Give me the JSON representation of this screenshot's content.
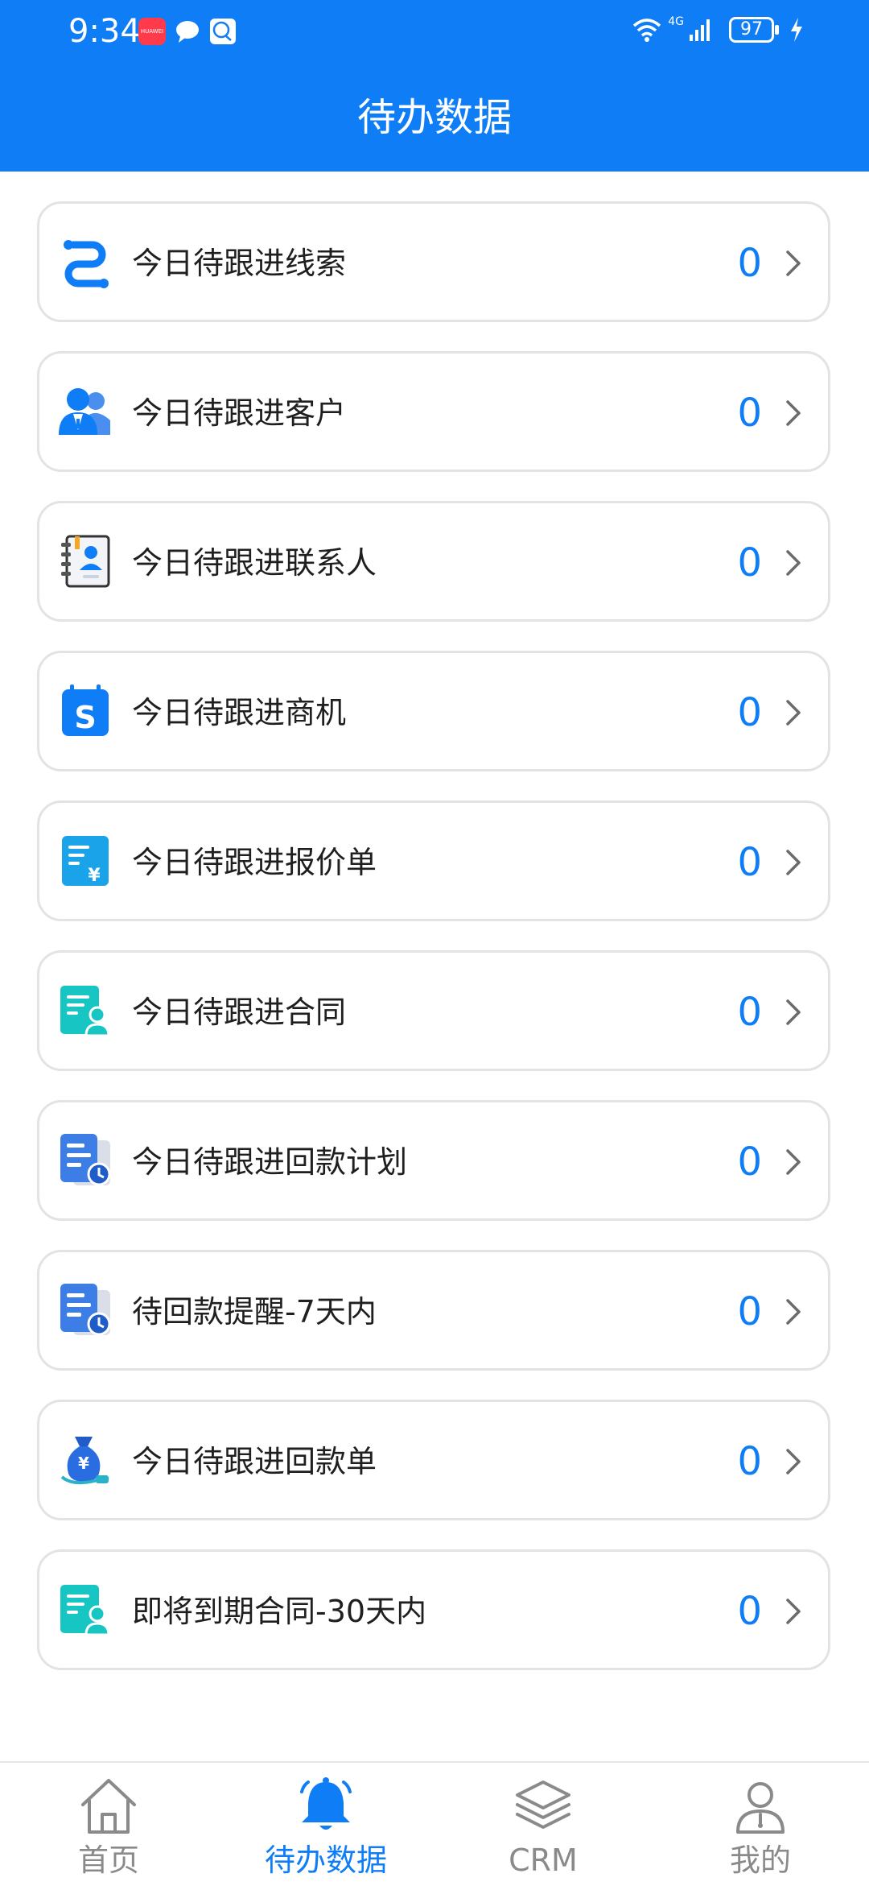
{
  "status_bar": {
    "time": "9:34",
    "notif_app": "HUAWEI",
    "network": "4G",
    "battery": "97"
  },
  "header": {
    "title": "待办数据"
  },
  "items": [
    {
      "label": "今日待跟进线索",
      "count": "0",
      "icon": "leads-icon"
    },
    {
      "label": "今日待跟进客户",
      "count": "0",
      "icon": "customers-icon"
    },
    {
      "label": "今日待跟进联系人",
      "count": "0",
      "icon": "contacts-icon"
    },
    {
      "label": "今日待跟进商机",
      "count": "0",
      "icon": "opportunity-icon"
    },
    {
      "label": "今日待跟进报价单",
      "count": "0",
      "icon": "quotation-icon"
    },
    {
      "label": "今日待跟进合同",
      "count": "0",
      "icon": "contract-icon"
    },
    {
      "label": "今日待跟进回款计划",
      "count": "0",
      "icon": "payment-plan-icon"
    },
    {
      "label": "待回款提醒-7天内",
      "count": "0",
      "icon": "payment-plan-icon"
    },
    {
      "label": "今日待跟进回款单",
      "count": "0",
      "icon": "money-bag-icon"
    },
    {
      "label": "即将到期合同-30天内",
      "count": "0",
      "icon": "contract-icon"
    }
  ],
  "nav": [
    {
      "label": "首页",
      "icon": "home-icon",
      "active": false
    },
    {
      "label": "待办数据",
      "icon": "bell-icon",
      "active": true
    },
    {
      "label": "CRM",
      "icon": "layers-icon",
      "active": false
    },
    {
      "label": "我的",
      "icon": "user-icon",
      "active": false
    }
  ],
  "colors": {
    "primary": "#0f7ef6",
    "card_border": "#e3e3e3",
    "nav_inactive": "#8a8a8a"
  }
}
